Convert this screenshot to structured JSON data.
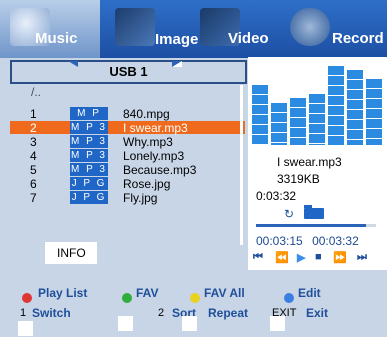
{
  "tabs": [
    {
      "label": "Music"
    },
    {
      "label": "Image"
    },
    {
      "label": "Video"
    },
    {
      "label": "Record"
    }
  ],
  "source": {
    "title": "USB 1"
  },
  "list": {
    "parent": "/..",
    "rows": [
      {
        "num": "1",
        "type": "M P G",
        "name": "840.mpg"
      },
      {
        "num": "2",
        "type": "M P 3",
        "name": "I swear.mp3"
      },
      {
        "num": "3",
        "type": "M P 3",
        "name": "Why.mp3"
      },
      {
        "num": "4",
        "type": "M P 3",
        "name": "Lonely.mp3"
      },
      {
        "num": "5",
        "type": "M P 3",
        "name": "Because.mp3"
      },
      {
        "num": "6",
        "type": "J P G",
        "name": "Rose.jpg"
      },
      {
        "num": "7",
        "type": "J P G",
        "name": "Fly.jpg"
      }
    ],
    "selected_index": 1,
    "info_label": "INFO"
  },
  "now_playing": {
    "title": "I swear.mp3",
    "size": "3319KB",
    "duration": "0:03:32",
    "elapsed": "00:03:15",
    "total": "00:03:32",
    "progress": 0.92,
    "spectrum_levels": [
      0.72,
      0.5,
      0.57,
      0.62,
      0.95,
      0.9,
      0.8
    ]
  },
  "controls": [
    "prev",
    "rewind",
    "play",
    "stop",
    "fast-forward",
    "next"
  ],
  "hints": {
    "red": "Play List",
    "green": "FAV",
    "yellow": "FAV All",
    "blue": "Edit",
    "switch_key": "1",
    "switch_label": "Switch",
    "sort_key": "2",
    "sort_label": "Sort",
    "repeat_label": "Repeat",
    "exit_key": "EXIT",
    "exit_label": "Exit"
  },
  "colors": {
    "selected": "#ef6a1d",
    "red": "#e03535",
    "green": "#2fae3b",
    "yellow": "#e8d21f",
    "blue": "#3a7fe0"
  }
}
